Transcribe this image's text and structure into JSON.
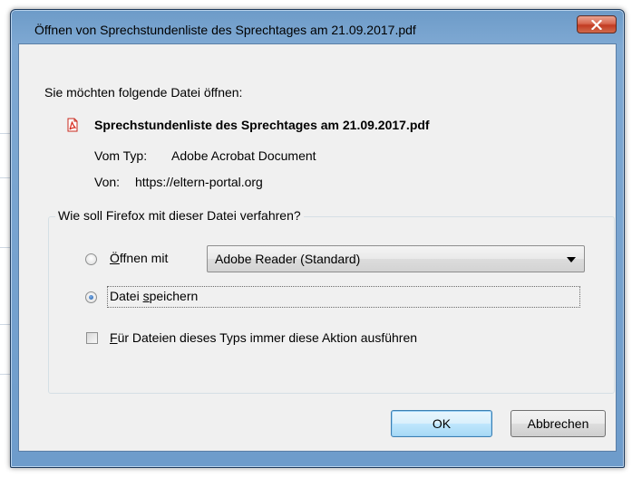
{
  "window": {
    "title": "Öffnen von Sprechstundenliste des Sprechtages am 21.09.2017.pdf",
    "close_label": "X"
  },
  "prompt": "Sie möchten folgende Datei öffnen:",
  "file": {
    "name": "Sprechstundenliste des Sprechtages am 21.09.2017.pdf",
    "icon": "pdf-icon",
    "type_label": "Vom Typ:",
    "type_value": "Adobe Acrobat Document",
    "from_label": "Von:",
    "from_value": "https://eltern-portal.org"
  },
  "action_group": {
    "legend": "Wie soll Firefox mit dieser Datei verfahren?",
    "open_with": {
      "mnemonic": "Ö",
      "label_rest": "ffnen mit",
      "checked": false
    },
    "application_select": {
      "selected": "Adobe Reader  (Standard)"
    },
    "save_file": {
      "label_pre": "Datei ",
      "mnemonic": "s",
      "label_post": "peichern",
      "checked": true
    },
    "always_do": {
      "mnemonic": "F",
      "label_rest": "ür Dateien dieses Typs immer diese Aktion ausführen",
      "checked": false
    }
  },
  "buttons": {
    "ok": "OK",
    "cancel": "Abbrechen"
  },
  "colors": {
    "frame": "#7fa9d3",
    "client_bg": "#f0f0f0",
    "close_button": "#c23b22",
    "pdf_icon": "#d8291c"
  }
}
